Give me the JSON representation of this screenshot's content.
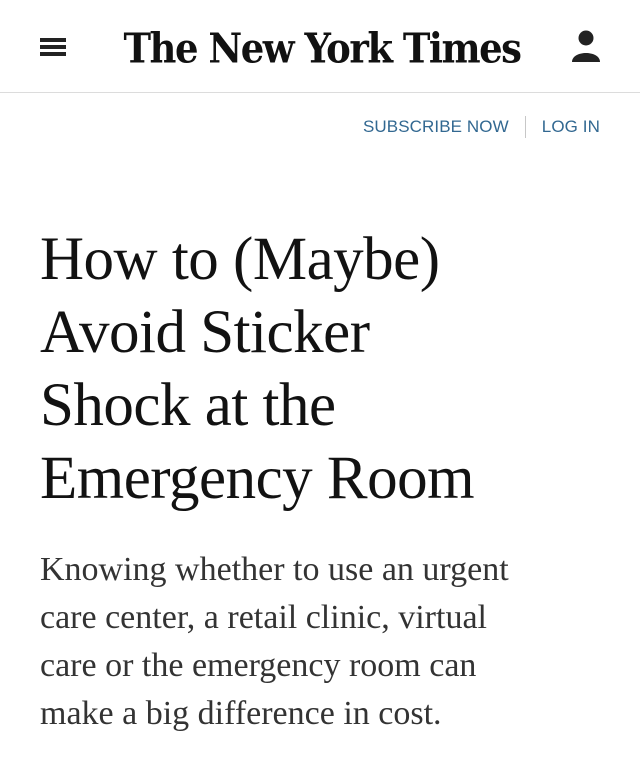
{
  "header": {
    "logo_text": "The New York Times",
    "menu_icon": "hamburger-menu-icon",
    "account_icon": "user-account-icon"
  },
  "auth": {
    "subscribe_label": "SUBSCRIBE NOW",
    "login_label": "LOG IN",
    "link_color": "#326891"
  },
  "article": {
    "headline_lines": [
      "How to (Maybe)",
      "Avoid Sticker",
      "Shock at the",
      "Emergency Room"
    ],
    "summary_lines": [
      "Knowing whether to use an urgent",
      "care center, a retail clinic, virtual",
      "care or the emergency room can",
      "make a big difference in cost."
    ]
  }
}
